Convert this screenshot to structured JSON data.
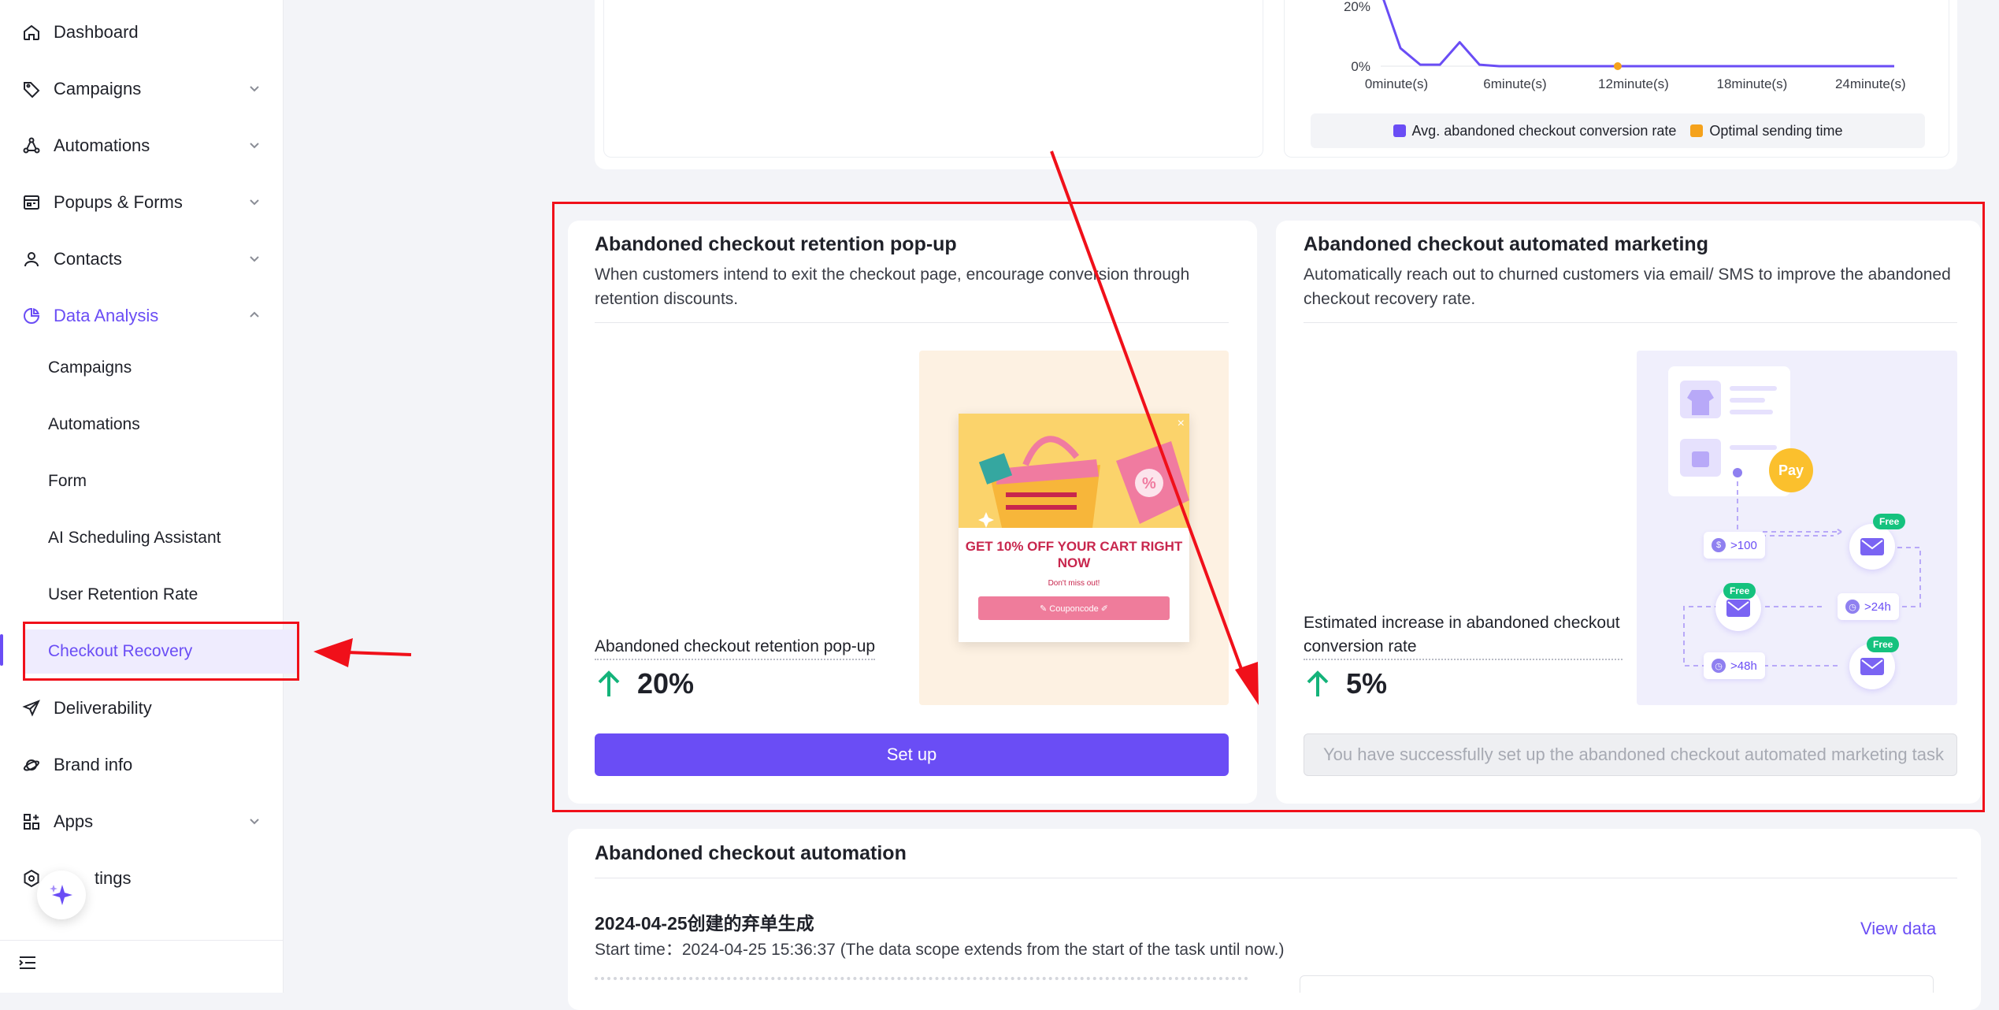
{
  "sidebar": {
    "items": [
      {
        "label": "Dashboard",
        "icon": "home-icon"
      },
      {
        "label": "Campaigns",
        "icon": "tag-icon"
      },
      {
        "label": "Automations",
        "icon": "automation-icon"
      },
      {
        "label": "Popups & Forms",
        "icon": "popup-icon"
      },
      {
        "label": "Contacts",
        "icon": "user-icon"
      },
      {
        "label": "Data Analysis",
        "icon": "pie-chart-icon"
      },
      {
        "label": "Deliverability",
        "icon": "send-icon"
      },
      {
        "label": "Brand info",
        "icon": "planet-icon"
      },
      {
        "label": "Apps",
        "icon": "apps-icon"
      },
      {
        "label": "Settings",
        "icon": "settings-icon"
      }
    ],
    "settings_visible": "tings",
    "data_analysis_sub": [
      {
        "label": "Campaigns"
      },
      {
        "label": "Automations"
      },
      {
        "label": "Form"
      },
      {
        "label": "AI Scheduling Assistant"
      },
      {
        "label": "User Retention Rate"
      },
      {
        "label": "Checkout Recovery"
      }
    ]
  },
  "chart": {
    "y_ticks": [
      "20%",
      "0%"
    ],
    "x_ticks": [
      "0minute(s)",
      "6minute(s)",
      "12minute(s)",
      "18minute(s)",
      "24minute(s)"
    ],
    "legend": [
      "Avg. abandoned checkout conversion rate",
      "Optimal sending time"
    ],
    "colors": {
      "line": "#6a4df5",
      "optimal": "#f5a21b"
    }
  },
  "chart_data": {
    "type": "line",
    "x": [
      0,
      1,
      2,
      3,
      4,
      5,
      6,
      9,
      12,
      15,
      18,
      21,
      24,
      26
    ],
    "series": [
      {
        "name": "Avg. abandoned checkout conversion rate",
        "values": [
          25,
          6,
          0.5,
          0.5,
          8,
          0.5,
          0,
          0,
          0,
          0,
          0,
          0,
          0,
          0
        ]
      }
    ],
    "optimal_point": {
      "x": 12,
      "y": 0
    },
    "ylabel_ticks": [
      "0%",
      "20%"
    ],
    "xlabel": ""
  },
  "retention_popup": {
    "title": "Abandoned checkout retention pop-up",
    "desc": "When customers intend to exit the checkout page, encourage conversion through retention discounts.",
    "metric_label": "Abandoned checkout retention pop-up",
    "metric_value": "20%",
    "button": "Set up",
    "preview": {
      "headline": "GET 10% OFF YOUR CART RIGHT NOW",
      "sub": "Don't miss out!",
      "coupon": "✎ Couponcode ✐",
      "close": "×"
    }
  },
  "automated_marketing": {
    "title": "Abandoned checkout automated marketing",
    "desc": "Automatically reach out to churned customers via email/ SMS to improve the abandoned checkout recovery rate.",
    "metric_label": "Estimated increase in abandoned checkout conversion rate",
    "metric_value": "5%",
    "button": "You have successfully set up the abandoned checkout automated marketing task",
    "flow": {
      "pay": "Pay",
      "chip_100": ">100",
      "chip_24h": ">24h",
      "chip_48h": ">48h",
      "free": "Free"
    }
  },
  "automation_list": {
    "title": "Abandoned checkout automation",
    "item_name": "2024-04-25创建的弃单生成",
    "start_time": "Start time：2024-04-25 15:36:37 (The data scope extends from the start of the task until now.)",
    "view_data": "View data"
  },
  "colors": {
    "accent": "#6a4df5",
    "annotation": "#f0101a",
    "positive": "#14b37a"
  }
}
